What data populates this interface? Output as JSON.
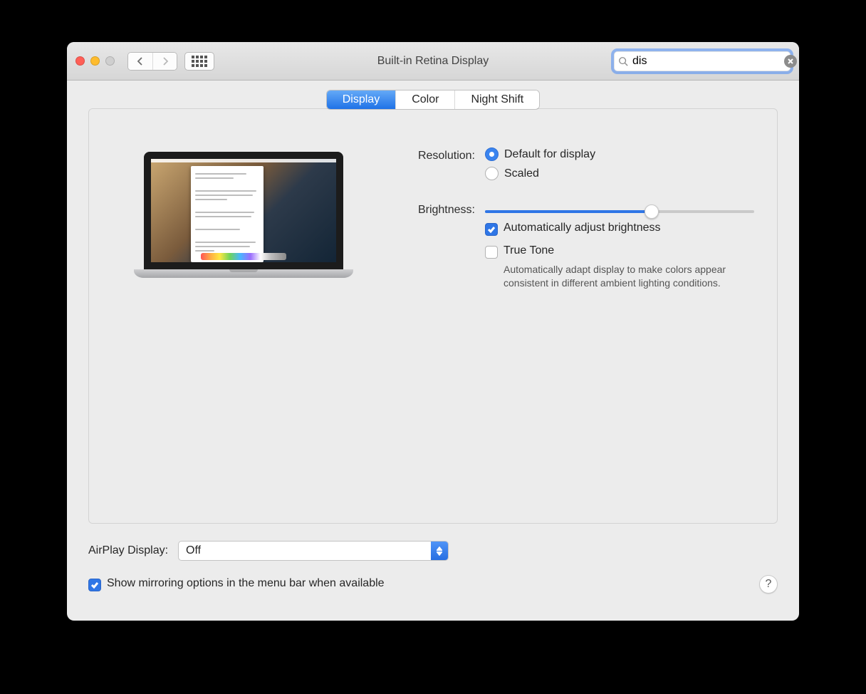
{
  "window": {
    "title": "Built-in Retina Display"
  },
  "search": {
    "value": "dis"
  },
  "tabs": {
    "display": "Display",
    "color": "Color",
    "night_shift": "Night Shift",
    "active": "display"
  },
  "settings": {
    "resolution": {
      "label": "Resolution:",
      "options": {
        "default": "Default for display",
        "scaled": "Scaled"
      },
      "selected": "default"
    },
    "brightness": {
      "label": "Brightness:",
      "value": 62,
      "auto_checked": true,
      "auto_label": "Automatically adjust brightness"
    },
    "true_tone": {
      "checked": false,
      "label": "True Tone",
      "description": "Automatically adapt display to make colors appear consistent in different ambient lighting conditions."
    }
  },
  "footer": {
    "airplay": {
      "label": "AirPlay Display:",
      "value": "Off"
    },
    "mirroring": {
      "checked": true,
      "label": "Show mirroring options in the menu bar when available"
    }
  }
}
